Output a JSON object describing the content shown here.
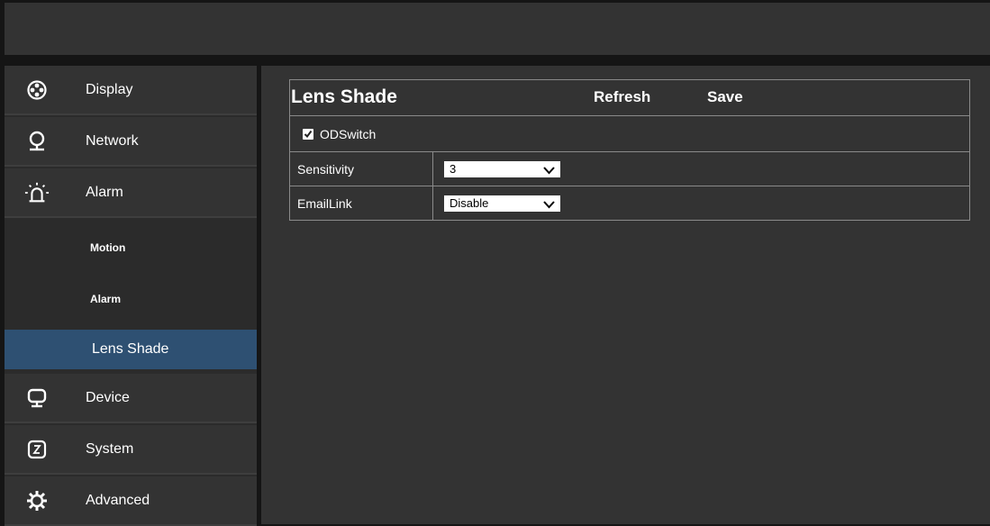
{
  "sidebar": {
    "items": [
      {
        "label": "Display",
        "icon": "film-reel-icon"
      },
      {
        "label": "Network",
        "icon": "globe-stand-icon"
      },
      {
        "label": "Alarm",
        "icon": "alarm-bulb-icon"
      },
      {
        "label": "Device",
        "icon": "monitor-icon"
      },
      {
        "label": "System",
        "icon": "clock-box-icon"
      },
      {
        "label": "Advanced",
        "icon": "gear-icon"
      }
    ],
    "alarm_submenu": [
      {
        "label": "Motion",
        "active": false
      },
      {
        "label": "Alarm",
        "active": false
      },
      {
        "label": "Lens Shade",
        "active": true
      }
    ]
  },
  "panel": {
    "title": "Lens Shade",
    "refresh_label": "Refresh",
    "save_label": "Save",
    "odswitch": {
      "label": "ODSwitch",
      "checked": true
    },
    "sensitivity": {
      "label": "Sensitivity",
      "value": "3"
    },
    "emaillink": {
      "label": "EmailLink",
      "value": "Disable"
    }
  },
  "colors": {
    "active_item": "#2e5072",
    "panel_bg": "#333333",
    "border": "#8a8a8a"
  }
}
